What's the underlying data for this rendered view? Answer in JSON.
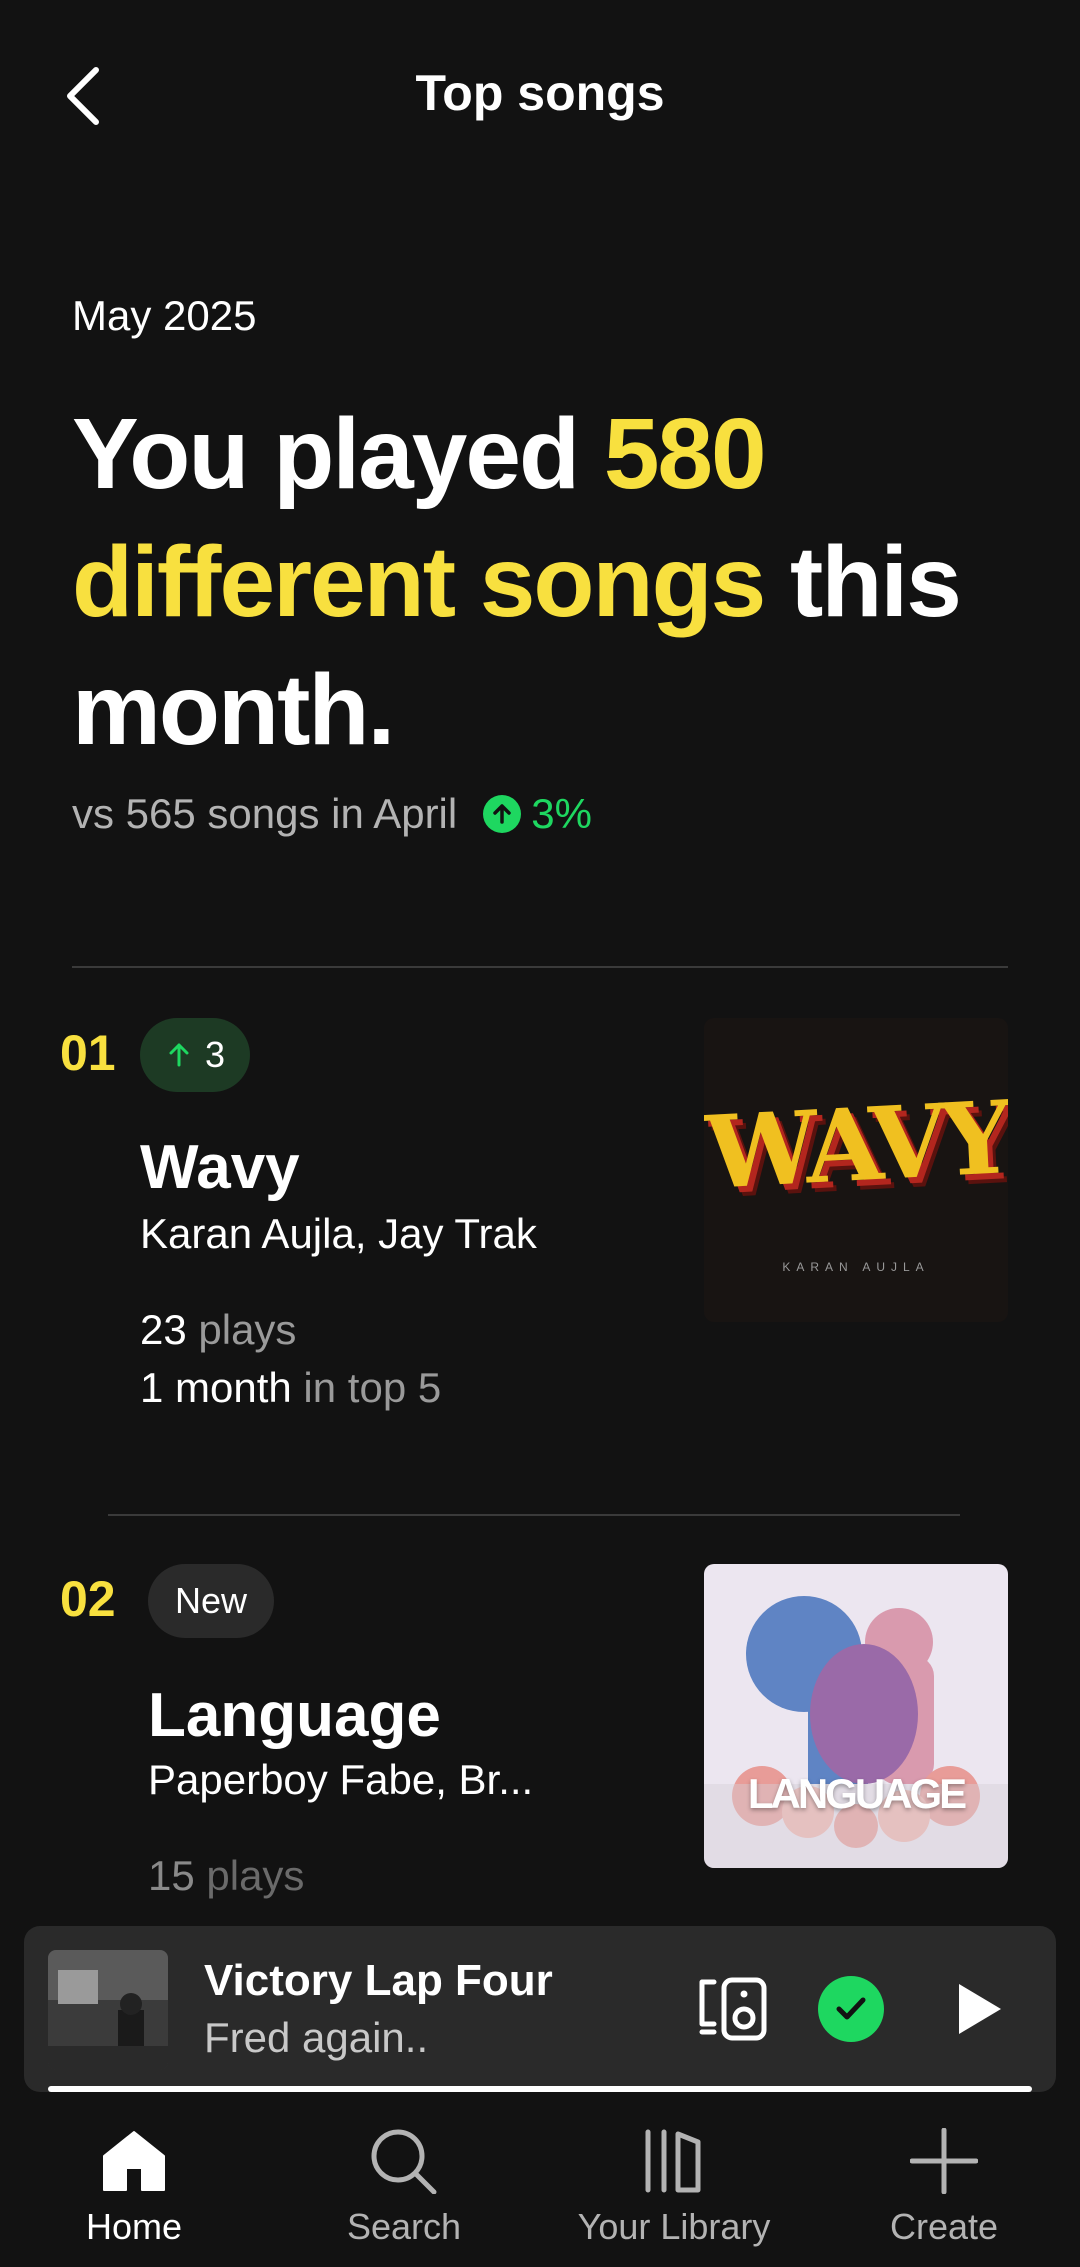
{
  "header": {
    "title": "Top songs"
  },
  "hero": {
    "month": "May 2025",
    "headline_a": "You played ",
    "headline_b": "580 different songs",
    "headline_c": " this month.",
    "compare": "vs 565 songs in April",
    "change": "3%"
  },
  "songs": [
    {
      "rank": "01",
      "badge": "3",
      "title": "Wavy",
      "artist": "Karan Aujla, Jay Trak",
      "plays_value": "23",
      "plays_label": " plays",
      "top_value": "1 month",
      "top_label": " in top 5",
      "art_text": "WAVY",
      "art_subtext": "KARAN AUJLA"
    },
    {
      "rank": "02",
      "badge": "New",
      "title": "Language",
      "artist": "Paperboy Fabe, Br...",
      "plays_value": "15",
      "plays_label": " plays",
      "art_text": "LANGUAGE"
    }
  ],
  "player": {
    "title": "Victory Lap Four",
    "artist": "Fred again.."
  },
  "nav": {
    "home": "Home",
    "search": "Search",
    "library": "Your Library",
    "create": "Create"
  },
  "colors": {
    "accent_yellow": "#f8e03f",
    "spotify_green": "#1ed760",
    "background": "#121212"
  }
}
